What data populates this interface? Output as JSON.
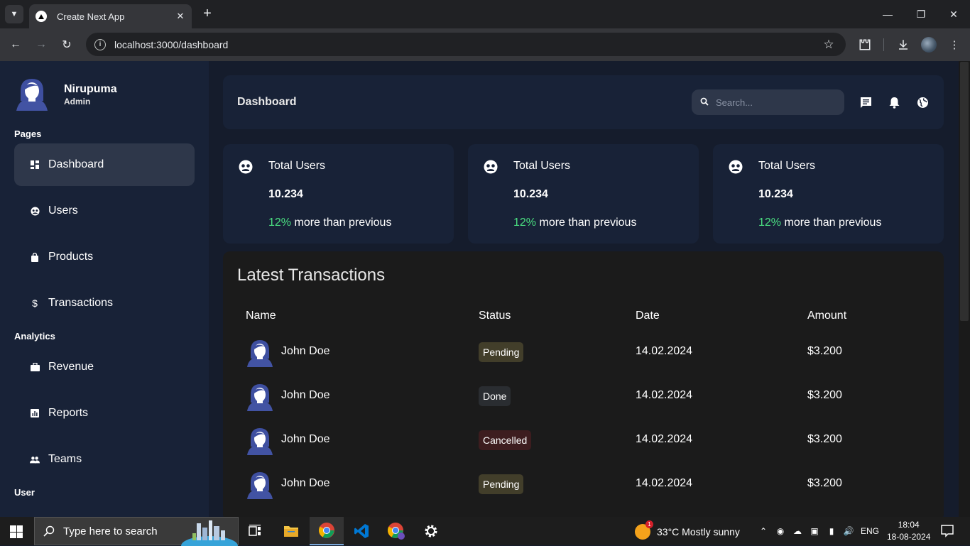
{
  "browser": {
    "tab_title": "Create Next App",
    "url": "localhost:3000/dashboard"
  },
  "sidebar": {
    "user_name": "Nirupuma",
    "user_role": "Admin",
    "sections": {
      "pages": "Pages",
      "analytics": "Analytics",
      "user": "User"
    },
    "items": [
      {
        "label": "Dashboard",
        "icon": "dashboard-icon"
      },
      {
        "label": "Users",
        "icon": "users-icon"
      },
      {
        "label": "Products",
        "icon": "shopping-bag-icon"
      },
      {
        "label": "Transactions",
        "icon": "dollar-icon"
      },
      {
        "label": "Revenue",
        "icon": "briefcase-icon"
      },
      {
        "label": "Reports",
        "icon": "analytics-icon"
      },
      {
        "label": "Teams",
        "icon": "team-icon"
      }
    ]
  },
  "topbar": {
    "title": "Dashboard",
    "search_placeholder": "Search..."
  },
  "cards": [
    {
      "title": "Total Users",
      "number": "10.234",
      "percent": "12%",
      "detail": "more than previous"
    },
    {
      "title": "Total Users",
      "number": "10.234",
      "percent": "12%",
      "detail": "more than previous"
    },
    {
      "title": "Total Users",
      "number": "10.234",
      "percent": "12%",
      "detail": "more than previous"
    }
  ],
  "transactions": {
    "title": "Latest Transactions",
    "columns": [
      "Name",
      "Status",
      "Date",
      "Amount"
    ],
    "rows": [
      {
        "name": "John Doe",
        "status": "Pending",
        "date": "14.02.2024",
        "amount": "$3.200"
      },
      {
        "name": "John Doe",
        "status": "Done",
        "date": "14.02.2024",
        "amount": "$3.200"
      },
      {
        "name": "John Doe",
        "status": "Cancelled",
        "date": "14.02.2024",
        "amount": "$3.200"
      },
      {
        "name": "John Doe",
        "status": "Pending",
        "date": "14.02.2024",
        "amount": "$3.200"
      }
    ]
  },
  "colors": {
    "sidebar_bg": "#182237",
    "main_bg": "#151c2c",
    "positive": "#4ade80",
    "pending": "#423e2a",
    "done": "#2a2d31",
    "cancelled": "#3d1d1f"
  },
  "taskbar": {
    "search_text": "Type here to search",
    "weather_temp": "33°C",
    "weather_desc": "Mostly sunny",
    "weather_badge": "1",
    "language": "ENG",
    "time": "18:04",
    "date": "18-08-2024"
  }
}
